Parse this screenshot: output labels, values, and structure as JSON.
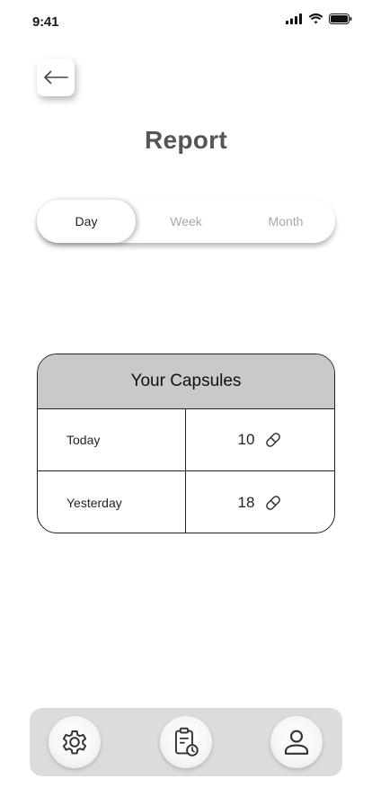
{
  "status_bar": {
    "time": "9:41"
  },
  "header": {
    "title": "Report"
  },
  "tabs": [
    {
      "label": "Day",
      "active": true
    },
    {
      "label": "Week",
      "active": false
    },
    {
      "label": "Month",
      "active": false
    }
  ],
  "capsules": {
    "title": "Your Capsules",
    "rows": [
      {
        "label": "Today",
        "value": "10"
      },
      {
        "label": "Yesterday",
        "value": "18"
      }
    ]
  },
  "bottom_nav": {
    "items": [
      {
        "icon": "gear-icon"
      },
      {
        "icon": "clipboard-clock-icon"
      },
      {
        "icon": "user-icon"
      }
    ]
  },
  "colors": {
    "background": "#ffffff",
    "header_fill": "#c9c9c9",
    "nav_bar": "#dcdcdc",
    "title": "#555555",
    "inactive_tab": "#a8a8a8"
  }
}
